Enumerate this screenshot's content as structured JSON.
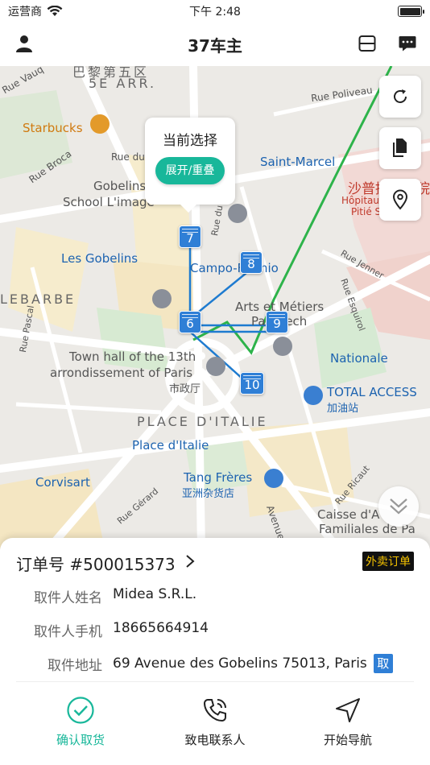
{
  "status_bar": {
    "carrier": "运营商",
    "time": "下午 2:48"
  },
  "nav": {
    "title": "37车主"
  },
  "map": {
    "labels": {
      "arr": "5E ARR.",
      "district_top": "巴黎第五区",
      "starbucks": "Starbucks",
      "rue_broca": "Rue Broca",
      "rue_du_f": "Rue du F",
      "rue_poliveau": "Rue Poliveau",
      "saint_marcel": "Saint-Marcel",
      "gobelins_school": "Gobelins",
      "school_limage": "School L'image",
      "les_gobelins": "Les Gobelins",
      "campo_formio": "Campo-Formio",
      "lebarbe": "LEBARBE",
      "arts_metiers": "Arts et Métiers",
      "paristech": "ParisTech",
      "town_hall_1": "Town hall of the 13th",
      "town_hall_2": "arrondissement of Paris",
      "town_hall_cn": "市政厅",
      "nationale": "Nationale",
      "total_access": "TOTAL ACCESS",
      "gas_station": "加油站",
      "place_italie_area": "PLACE D'ITALIE",
      "place_italie_metro": "Place d'Italie",
      "corvisart": "Corvisart",
      "tang_freres": "Tang Frères",
      "tang_cn": "亚洲杂货店",
      "caisse_1": "Caisse d'A",
      "caisse_2": "Familiales de Pa",
      "hospital_cn": "沙普提耶医院",
      "hospital_1": "Hôpitaux Un",
      "hospital_2": "Pitié S",
      "rue_jenner": "Rue Jenner",
      "rue_esquirol": "Rue Esquirol",
      "rue_pascal": "Rue Pascal",
      "rue_ricaut": "Rue Ricaut",
      "rue_gerard": "Rue Gérard",
      "avenue": "Avenue",
      "rue_vauq": "Rue Vauq",
      "rue_du_b": "Rue du B"
    },
    "popup": {
      "title": "当前选择",
      "button": "展开/重叠"
    },
    "pins": [
      "7",
      "8",
      "6",
      "9",
      "10"
    ],
    "route_color": "#1e7bd0",
    "metro_line_color": "#2db34a"
  },
  "order": {
    "number": "订单号 #500015373",
    "type_badge": "外卖订单",
    "fields": [
      {
        "label": "取件人姓名",
        "value": "Midea S.R.L."
      },
      {
        "label": "取件人手机",
        "value": "18665664914"
      },
      {
        "label": "取件地址",
        "value": "69 Avenue des Gobelins 75013, Paris"
      }
    ],
    "address_badge": "取"
  },
  "actions": [
    {
      "label": "确认取货"
    },
    {
      "label": "致电联系人"
    },
    {
      "label": "开始导航"
    }
  ],
  "accent_color": "#18b79a"
}
